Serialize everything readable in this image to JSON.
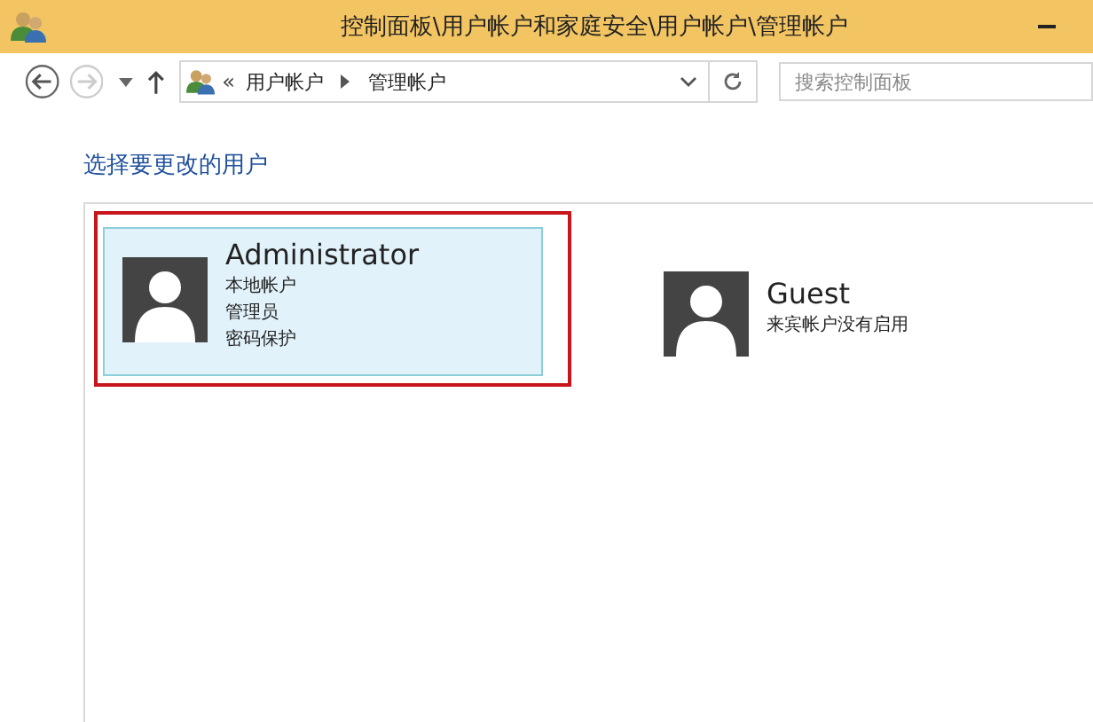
{
  "window": {
    "title": "控制面板\\用户帐户和家庭安全\\用户帐户\\管理帐户"
  },
  "address_bar": {
    "overflow": "«",
    "crumbs": [
      "用户帐户",
      "管理帐户"
    ]
  },
  "search": {
    "placeholder": "搜索控制面板"
  },
  "heading": "选择要更改的用户",
  "accounts": [
    {
      "name": "Administrator",
      "details": [
        "本地帐户",
        "管理员",
        "密码保护"
      ],
      "selected": true,
      "highlighted": true
    },
    {
      "name": "Guest",
      "details": [
        "来宾帐户没有启用"
      ],
      "selected": false,
      "highlighted": false
    }
  ]
}
